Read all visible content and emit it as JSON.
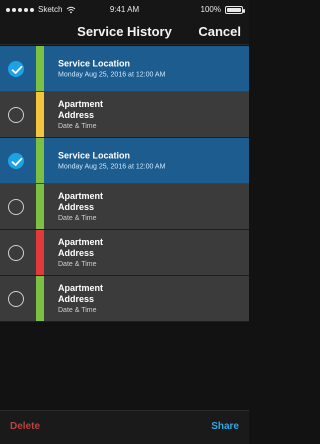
{
  "status_bar": {
    "carrier": "Sketch",
    "time": "9:41 AM",
    "battery": "100%"
  },
  "nav": {
    "title": "Service History",
    "cancel_label": "Cancel"
  },
  "rows": [
    {
      "title": "Service Location",
      "subtitle": "",
      "meta": "Monday Aug 25, 2016 at 12:00 AM",
      "selected": true,
      "accent_color": "#7bc043"
    },
    {
      "title": "Apartment",
      "subtitle": "Address",
      "meta": "Date & Time",
      "selected": false,
      "accent_color": "#f2c53d"
    },
    {
      "title": "Service Location",
      "subtitle": "",
      "meta": "Monday Aug 25, 2016 at 12:00 AM",
      "selected": true,
      "accent_color": "#7bc043"
    },
    {
      "title": "Apartment",
      "subtitle": "Address",
      "meta": "Date & Time",
      "selected": false,
      "accent_color": "#7bc043"
    },
    {
      "title": "Apartment",
      "subtitle": "Address",
      "meta": "Date & Time",
      "selected": false,
      "accent_color": "#e23a3a"
    },
    {
      "title": "Apartment",
      "subtitle": "Address",
      "meta": "Date & Time",
      "selected": false,
      "accent_color": "#7bc043"
    }
  ],
  "bottom_bar": {
    "delete_label": "Delete",
    "share_label": "Share"
  },
  "colors": {
    "selected_row": "#1c5c8e",
    "unselected_row": "#3b3b3b",
    "checkbox_selected": "#1ba3e8",
    "delete_text": "#b94343",
    "share_text": "#2ca7e6"
  },
  "icons": {
    "wifi": "wifi-icon",
    "battery": "battery-icon",
    "check": "checkmark-icon"
  }
}
